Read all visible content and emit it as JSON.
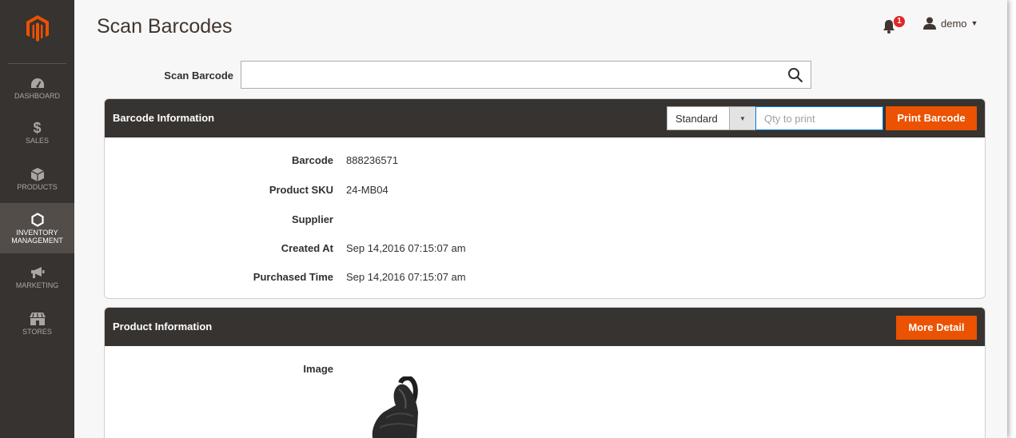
{
  "sidebar": {
    "logo": "magento-logo",
    "items": [
      {
        "label": "DASHBOARD",
        "icon": "dashboard-icon"
      },
      {
        "label": "SALES",
        "icon": "dollar-icon"
      },
      {
        "label": "PRODUCTS",
        "icon": "box-icon"
      },
      {
        "label": "INVENTORY MANAGEMENT",
        "icon": "hexagon-icon",
        "active": true
      },
      {
        "label": "MARKETING",
        "icon": "megaphone-icon"
      },
      {
        "label": "STORES",
        "icon": "store-icon"
      }
    ]
  },
  "header": {
    "title": "Scan Barcodes",
    "notification_count": "1",
    "user_name": "demo"
  },
  "scan": {
    "label": "Scan Barcode",
    "value": "",
    "placeholder": ""
  },
  "barcode_panel": {
    "title": "Barcode Information",
    "template_select": "Standard",
    "qty_placeholder": "Qty to print",
    "print_button": "Print Barcode",
    "rows": [
      {
        "label": "Barcode",
        "value": "888236571"
      },
      {
        "label": "Product SKU",
        "value": "24-MB04"
      },
      {
        "label": "Supplier",
        "value": ""
      },
      {
        "label": "Created At",
        "value": "Sep 14,2016 07:15:07 am"
      },
      {
        "label": "Purchased Time",
        "value": "Sep 14,2016 07:15:07 am"
      }
    ]
  },
  "product_panel": {
    "title": "Product Information",
    "more_button": "More Detail",
    "image_label": "Image"
  },
  "colors": {
    "sidebar_bg": "#373330",
    "sidebar_active": "#524d49",
    "accent_orange": "#eb5202",
    "logo_orange": "#eb5202",
    "focus_blue": "#007bdb",
    "badge_red": "#e22626"
  }
}
